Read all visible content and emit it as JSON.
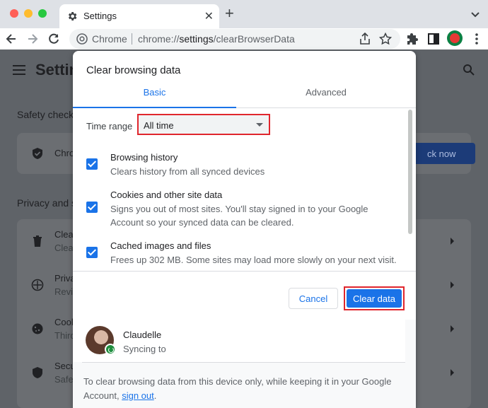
{
  "browser": {
    "tab_title": "Settings",
    "omnibox_site": "Chrome",
    "url_prefix": "chrome://",
    "url_host": "settings",
    "url_path": "/clearBrowserData"
  },
  "background": {
    "title": "Settin",
    "safety_heading": "Safety check",
    "safety_row": "Chro",
    "safety_button": "ck now",
    "privacy_heading": "Privacy and s",
    "rows": [
      {
        "l1": "Clear",
        "l2": "Clear"
      },
      {
        "l1": "Priva",
        "l2": "Revie"
      },
      {
        "l1": "Cook",
        "l2": "Third"
      },
      {
        "l1": "Secu",
        "l2": "Safe"
      }
    ]
  },
  "dialog": {
    "title": "Clear browsing data",
    "tabs": {
      "basic": "Basic",
      "advanced": "Advanced"
    },
    "time_range_label": "Time range",
    "time_range_value": "All time",
    "options": [
      {
        "title": "Browsing history",
        "desc": "Clears history from all synced devices",
        "checked": true
      },
      {
        "title": "Cookies and other site data",
        "desc": "Signs you out of most sites. You'll stay signed in to your Google Account so your synced data can be cleared.",
        "checked": true
      },
      {
        "title": "Cached images and files",
        "desc": "Frees up 302 MB. Some sites may load more slowly on your next visit.",
        "checked": true
      }
    ],
    "cancel_label": "Cancel",
    "clear_label": "Clear data",
    "account": {
      "name": "Claudelle",
      "status": "Syncing to"
    },
    "footnote_text": "To clear browsing data from this device only, while keeping it in your Google Account, ",
    "footnote_link": "sign out",
    "footnote_end": "."
  },
  "colors": {
    "accent": "#1a73e8",
    "highlight": "#e0262d"
  }
}
